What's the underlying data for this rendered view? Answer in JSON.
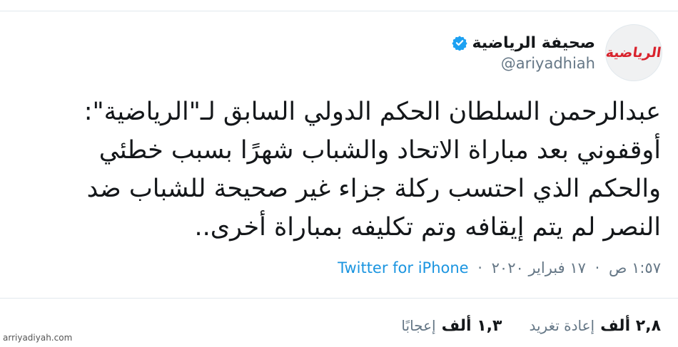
{
  "author": {
    "display_name": "صحيفة الرياضية",
    "handle": "@ariyadhiah",
    "avatar_logo_text": "الرياضية",
    "verified_icon": "verified-badge-icon"
  },
  "tweet": {
    "lines": [
      "عبدالرحمن السلطان الحكم الدولي السابق لـ\"الرياضية\":",
      "أوقفوني بعد مباراة الاتحاد والشباب شهرًا بسبب خطئي",
      "والحكم الذي احتسب ركلة جزاء غير صحيحة للشباب ضد",
      "النصر لم يتم إيقافه وتم تكليفه بمباراة أخرى.."
    ],
    "time": "١:٥٧ ص",
    "separator": "·",
    "date": "١٧ فبراير ٢٠٢٠",
    "source": "Twitter for iPhone"
  },
  "stats": {
    "retweets_count": "٢,٨ ألف",
    "retweets_label": "إعادة تغريد",
    "likes_count": "١,٣ ألف",
    "likes_label": "إعجابًا"
  },
  "watermark": "arriyadiyah.com",
  "colors": {
    "link": "#1b95e0",
    "muted": "#657786",
    "text": "#14171a",
    "brand_red": "#d9232d",
    "verified": "#1da1f2"
  }
}
